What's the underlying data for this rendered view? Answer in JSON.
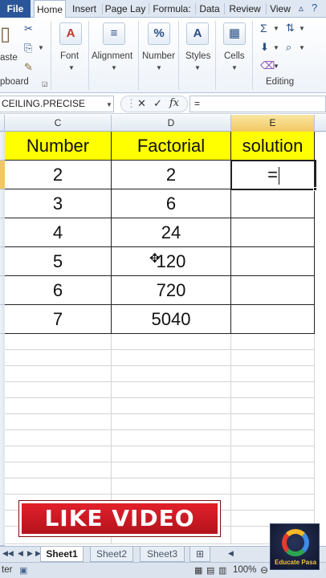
{
  "ribbon_tabs": [
    {
      "label": "File"
    },
    {
      "label": "Home"
    },
    {
      "label": "Insert"
    },
    {
      "label": "Page Lay"
    },
    {
      "label": "Formula:"
    },
    {
      "label": "Data"
    },
    {
      "label": "Review"
    },
    {
      "label": "View"
    }
  ],
  "ribbon_groups": {
    "clipboard_paste_label": "aste",
    "clipboard_label": "pboard",
    "font_label": "Font",
    "alignment_label": "Alignment",
    "number_label": "Number",
    "styles_label": "Styles",
    "cells_label": "Cells",
    "editing_label": "Editing"
  },
  "formula_bar": {
    "name_box": "CEILING.PRECISE",
    "formula": "="
  },
  "column_headers": [
    "C",
    "D",
    "E"
  ],
  "table": {
    "headers": [
      "Number",
      "Factorial",
      "solution"
    ],
    "rows": [
      [
        "2",
        "2",
        "="
      ],
      [
        "3",
        "6",
        ""
      ],
      [
        "4",
        "24",
        ""
      ],
      [
        "5",
        "120",
        ""
      ],
      [
        "6",
        "720",
        ""
      ],
      [
        "7",
        "5040",
        ""
      ]
    ]
  },
  "sheet_tabs": [
    {
      "label": "Sheet1"
    },
    {
      "label": "Sheet2"
    },
    {
      "label": "Sheet3"
    }
  ],
  "status_bar": {
    "mode": "ter",
    "zoom": "100%"
  },
  "overlay": {
    "banner_text": "LIKE VIDEO",
    "logo_text": "Educate Pasa"
  },
  "colors": {
    "header_fill": "#ffff00",
    "selected_header": "#f1c861",
    "file_tab": "#2a5699",
    "banner": "#d81e28"
  },
  "icons": [
    "paste-icon",
    "cut-icon",
    "copy-icon",
    "format-painter-icon",
    "font-icon",
    "alignment-icon",
    "percent-icon",
    "styles-icon",
    "cells-icon",
    "autosum-icon",
    "fill-icon",
    "clear-icon",
    "sort-filter-icon",
    "find-icon",
    "cancel-icon",
    "enter-icon",
    "fx-icon"
  ]
}
